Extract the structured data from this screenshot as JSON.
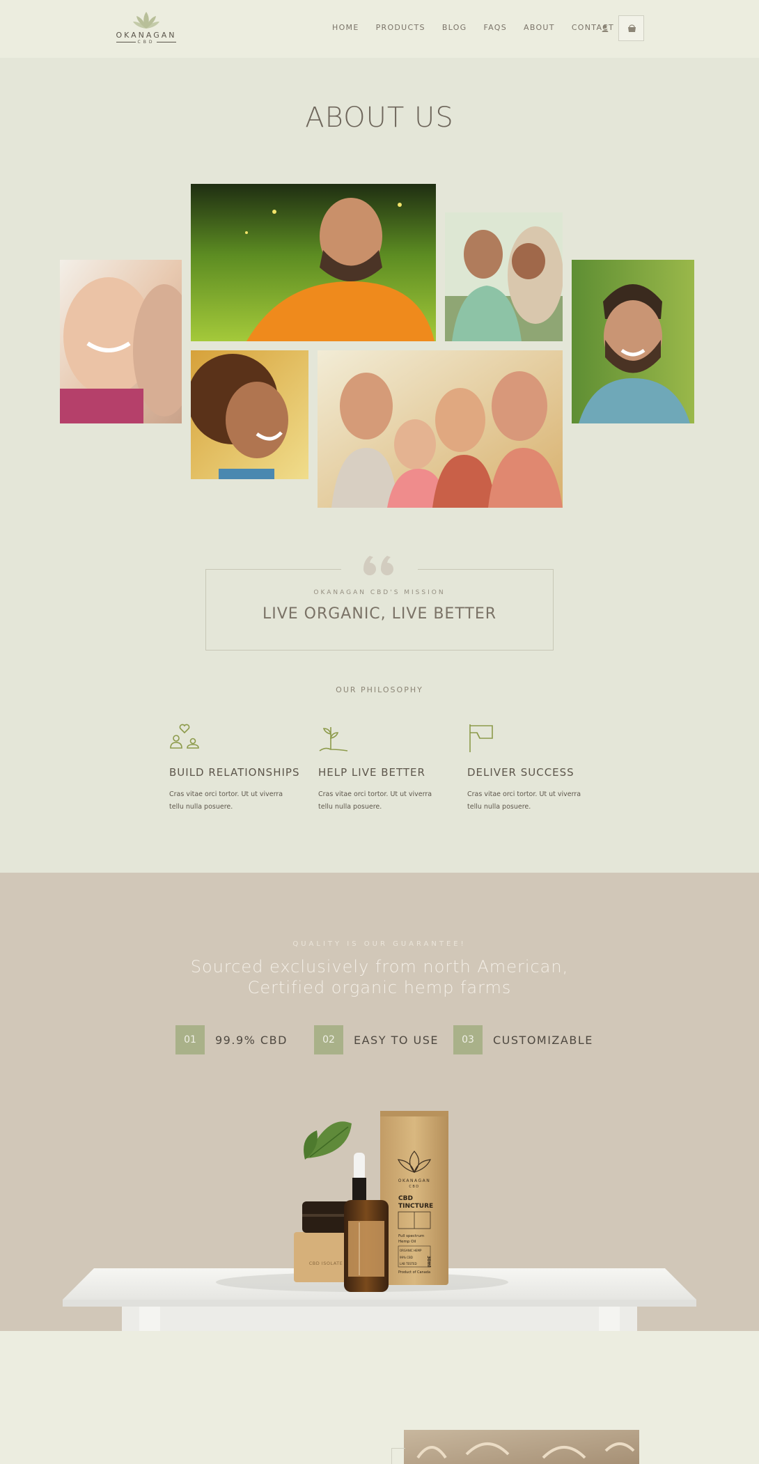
{
  "header": {
    "logo_text": "OKANAGAN",
    "logo_sub": "CBD",
    "nav": [
      "HOME",
      "PRODUCTS",
      "BLOG",
      "FAQS",
      "ABOUT",
      "CONTACT"
    ],
    "user_icon": "user-icon",
    "cart_icon": "cart-icon"
  },
  "about": {
    "title": "ABOUT US"
  },
  "mission": {
    "label": "OKANAGAN CBD'S MISSION",
    "title": "LIVE ORGANIC, LIVE BETTER"
  },
  "philosophy": {
    "label": "OUR PHILOSOPHY",
    "items": [
      {
        "title": "BUILD RELATIONSHIPS",
        "text": "Cras vitae orci tortor. Ut ut viverra tellu nulla posuere.",
        "icon": "people-heart-icon"
      },
      {
        "title": "HELP LIVE BETTER",
        "text": "Cras vitae orci tortor. Ut ut viverra tellu nulla posuere.",
        "icon": "sprout-icon"
      },
      {
        "title": "DELIVER SUCCESS",
        "text": "Cras vitae orci tortor. Ut ut viverra tellu nulla posuere.",
        "icon": "flag-icon"
      }
    ]
  },
  "quality": {
    "label": "QUALITY IS OUR GUARANTEE!",
    "title_line1": "Sourced exclusively from north American,",
    "title_line2": "Certified organic hemp farms",
    "features": [
      {
        "num": "01",
        "label": "99.9% CBD"
      },
      {
        "num": "02",
        "label": "EASY TO USE"
      },
      {
        "num": "03",
        "label": "CUSTOMIZABLE"
      }
    ],
    "product": {
      "tube_brand": "OKANAGAN",
      "tube_sub": "CBD",
      "tube_title1": "CBD",
      "tube_title2": "TINCTURE",
      "tube_desc1": "Full spectrum",
      "tube_desc2": "Hemp Oil",
      "tube_size": "30ml",
      "tube_tag1": "ORGANIC HEMP",
      "tube_tag2": "99% CBD",
      "tube_tag3": "LAB TESTED",
      "tube_origin": "Product of Canada",
      "jar_label": "CBD ISOLATE"
    }
  },
  "colors": {
    "page_bg": "#e4e6d8",
    "header_bg": "#eceddf",
    "quality_bg": "#d1c7b8",
    "accent": "#a9b189"
  }
}
